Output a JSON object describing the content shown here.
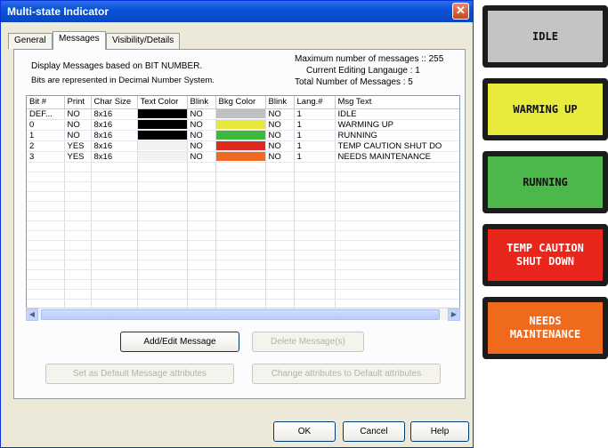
{
  "window": {
    "title": "Multi-state Indicator",
    "close_glyph": "✕"
  },
  "tabs": [
    {
      "label": "General"
    },
    {
      "label": "Messages"
    },
    {
      "label": "Visibility/Details"
    }
  ],
  "info": {
    "line1": "Display Messages based on BIT NUMBER.",
    "line2": "Bits are represented in Decimal Number System.",
    "max_messages": "Maximum number of messages :: 255",
    "current_language": "Current Editing Langauge :  1",
    "total_messages": "Total  Number of Messages :  5"
  },
  "grid": {
    "columns": [
      "Bit #",
      "Print",
      "Char Size",
      "Text Color",
      "Blink",
      "Bkg Color",
      "Blink",
      "Lang.#",
      "Msg Text"
    ],
    "rows": [
      {
        "bit": "DEF...",
        "print": "NO",
        "char_size": "8x16",
        "text_color": "#000000",
        "blink": "NO",
        "bkg_color": "#c0c0c0",
        "bkg_blink": "NO",
        "lang": "1",
        "msg": "IDLE"
      },
      {
        "bit": "0",
        "print": "NO",
        "char_size": "8x16",
        "text_color": "#000000",
        "blink": "NO",
        "bkg_color": "#e8e83a",
        "bkg_blink": "NO",
        "lang": "1",
        "msg": "WARMING UP"
      },
      {
        "bit": "1",
        "print": "NO",
        "char_size": "8x16",
        "text_color": "#000000",
        "blink": "NO",
        "bkg_color": "#3cb83c",
        "bkg_blink": "NO",
        "lang": "1",
        "msg": "RUNNING"
      },
      {
        "bit": "2",
        "print": "YES",
        "char_size": "8x16",
        "text_color": "#f2f2f2",
        "blink": "NO",
        "bkg_color": "#e02a20",
        "bkg_blink": "NO",
        "lang": "1",
        "msg": "TEMP CAUTION SHUT DO"
      },
      {
        "bit": "3",
        "print": "YES",
        "char_size": "8x16",
        "text_color": "#f2f2f2",
        "blink": "NO",
        "bkg_color": "#ef6a22",
        "bkg_blink": "NO",
        "lang": "1",
        "msg": "NEEDS MAINTENANCE"
      }
    ],
    "empty_rows": 15
  },
  "buttons": {
    "add_edit": "Add/Edit Message",
    "delete": "Delete Message(s)",
    "set_default": "Set as Default Message attributes",
    "change_default": "Change attributes to Default attributes",
    "ok": "OK",
    "cancel": "Cancel",
    "help": "Help"
  },
  "indicators": [
    {
      "text": "IDLE",
      "bg": "#c4c4c4",
      "fg": "#111111"
    },
    {
      "text": "WARMING UP",
      "bg": "#e8ea3c",
      "fg": "#111111"
    },
    {
      "text": "RUNNING",
      "bg": "#4cb84c",
      "fg": "#111111"
    },
    {
      "text": "TEMP CAUTION\nSHUT DOWN",
      "bg": "#e8261c",
      "fg": "#ffffff"
    },
    {
      "text": "NEEDS\nMAINTENANCE",
      "bg": "#f06a1e",
      "fg": "#ffffff"
    }
  ]
}
